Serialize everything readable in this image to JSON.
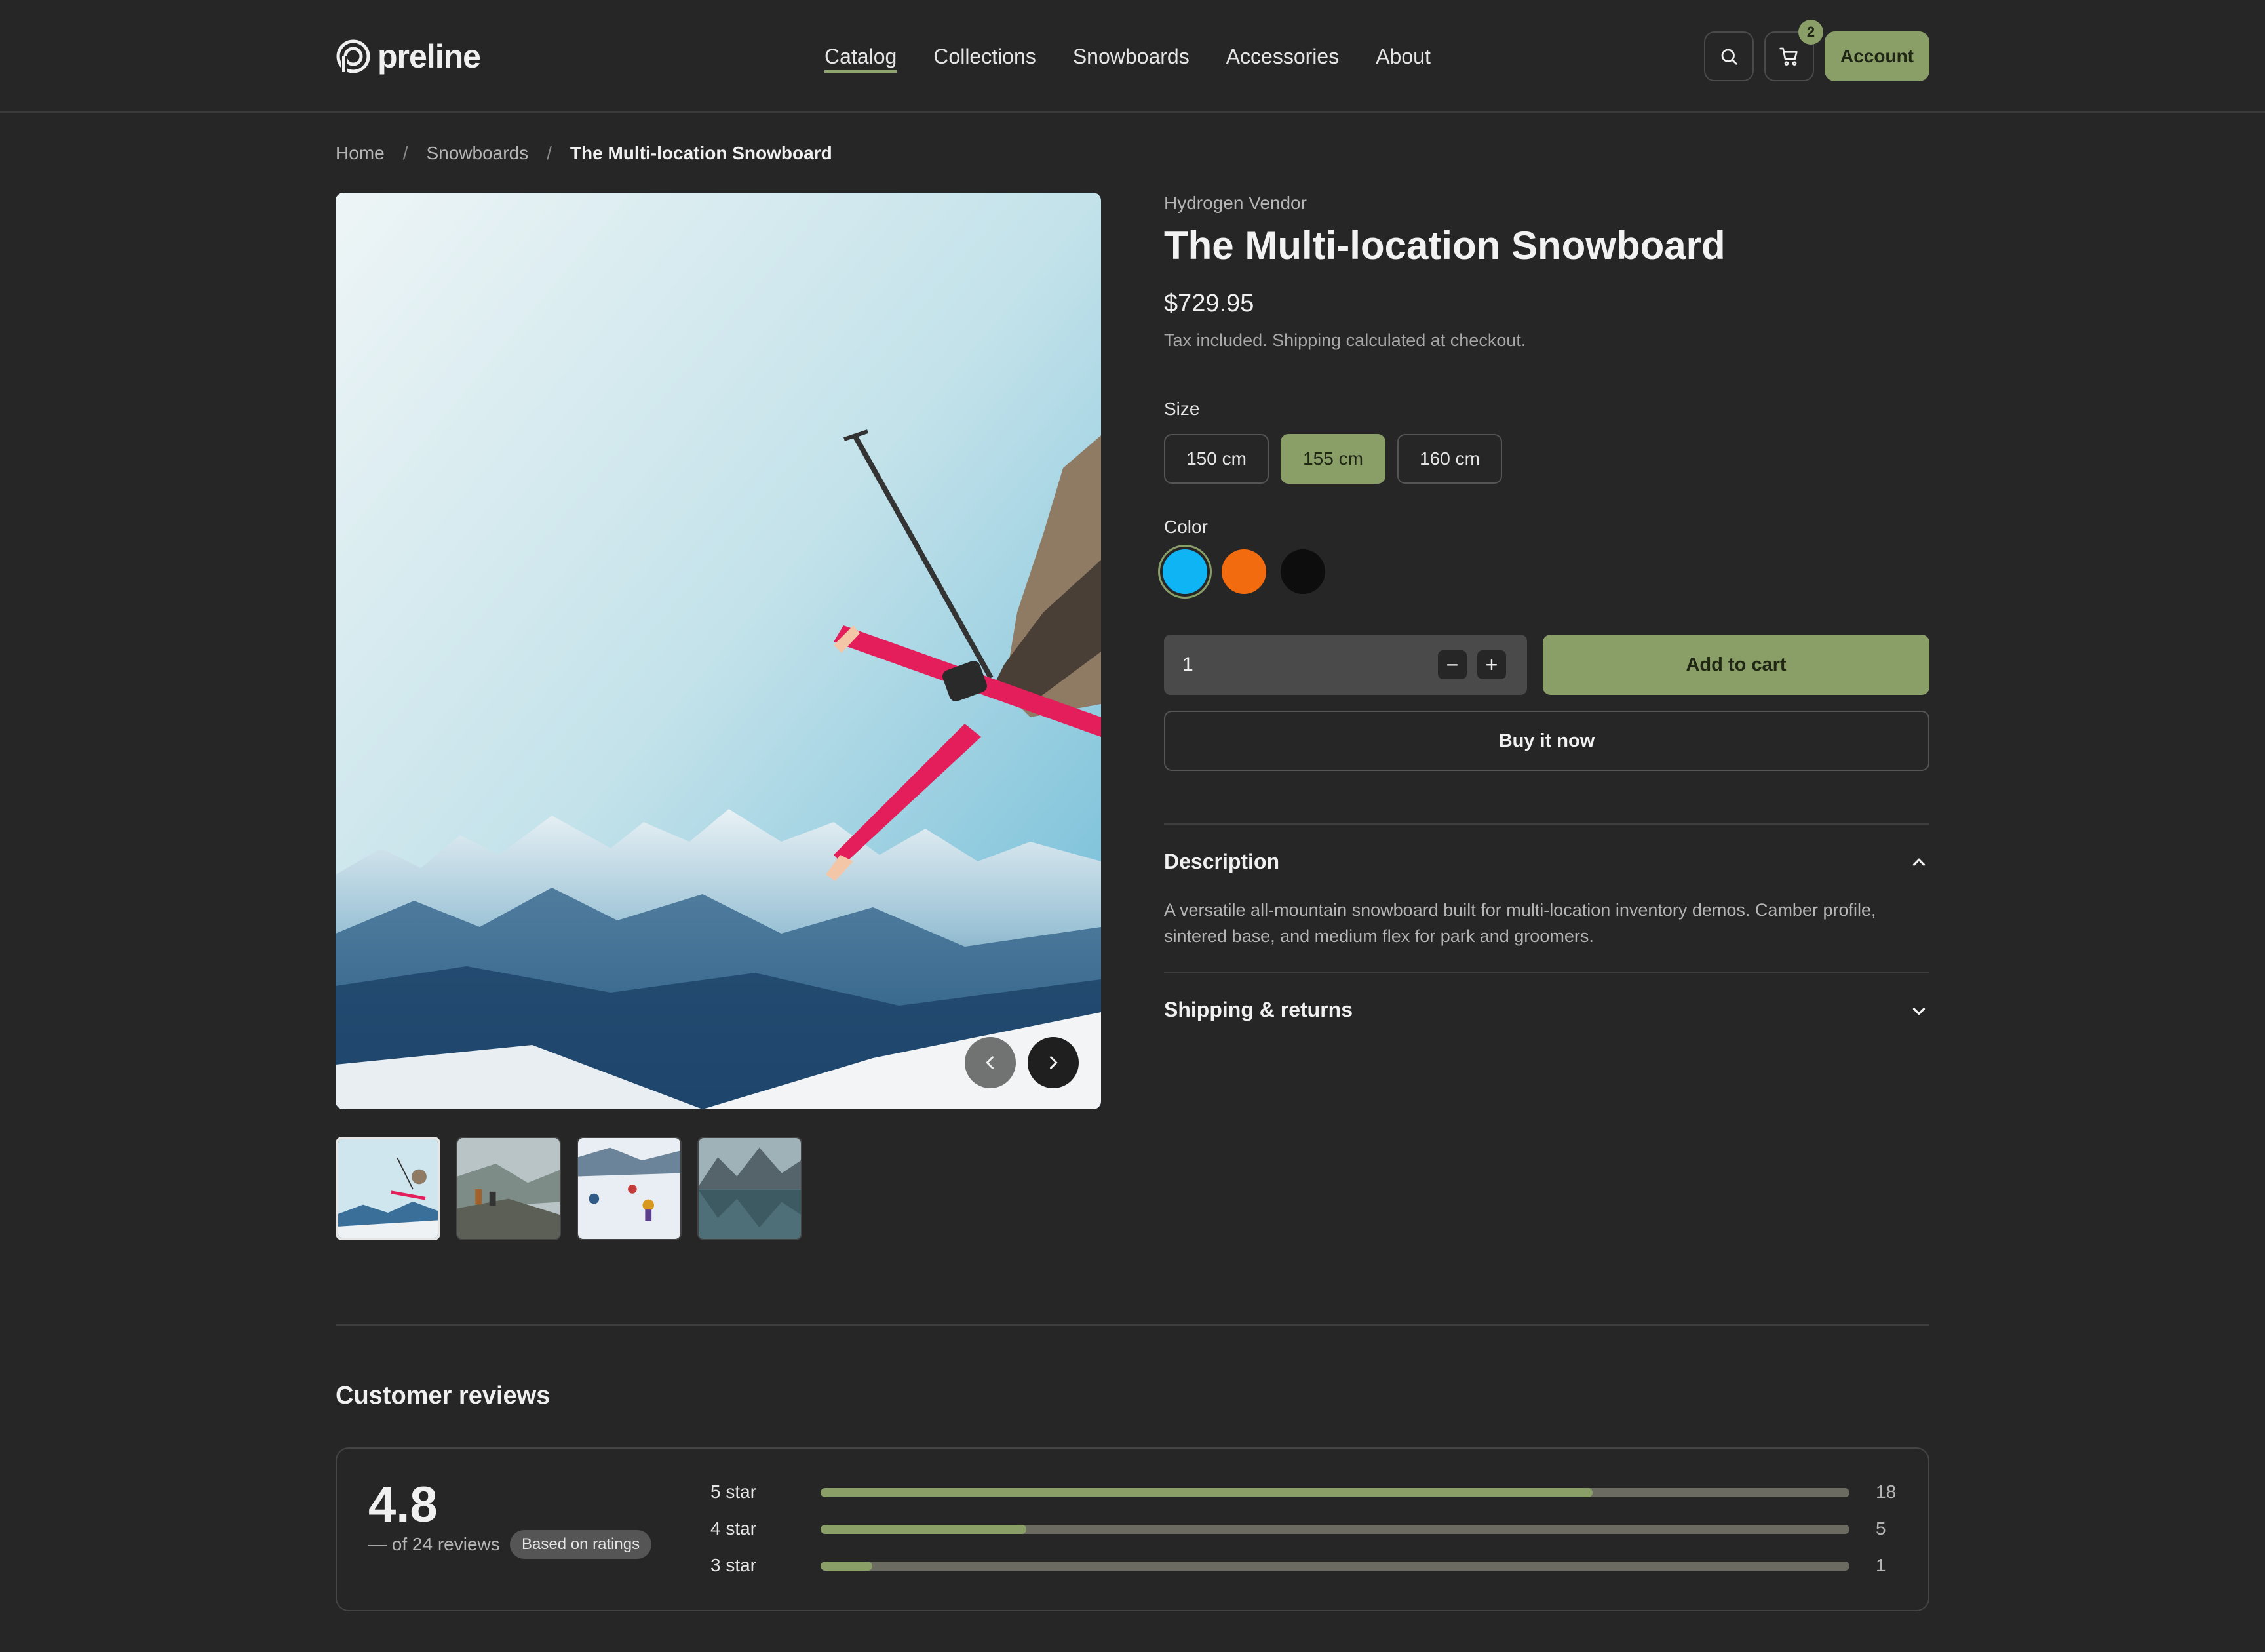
{
  "header": {
    "logo_text": "preline",
    "nav": [
      "Catalog",
      "Collections",
      "Snowboards",
      "Accessories",
      "About"
    ],
    "active_nav": "Catalog",
    "cart_count": "2",
    "account_label": "Account"
  },
  "breadcrumb": {
    "home": "Home",
    "category": "Snowboards",
    "current": "The Multi-location Snowboard"
  },
  "gallery": {
    "thumbnails": [
      "skier-jump",
      "hiker-cliff",
      "skiers-slope",
      "mountain-lake"
    ],
    "active_index": 0
  },
  "product": {
    "vendor": "Hydrogen Vendor",
    "title": "The Multi-location Snowboard",
    "price": "$729.95",
    "tax_note": "Tax included. Shipping calculated at checkout.",
    "size_label": "Size",
    "sizes": [
      "150 cm",
      "155 cm",
      "160 cm"
    ],
    "selected_size": "155 cm",
    "color_label": "Color",
    "colors": [
      "#0fb4f5",
      "#f26b0f",
      "#0d0d0d"
    ],
    "selected_color": "#0fb4f5",
    "quantity": "1",
    "minus": "−",
    "plus": "+",
    "add_to_cart": "Add to cart",
    "buy_now": "Buy it now"
  },
  "accordion": {
    "description_title": "Description",
    "description_text": "A versatile all-mountain snowboard built for multi-location inventory demos. Camber profile, sintered base, and medium flex for park and groomers.",
    "shipping_title": "Shipping & returns"
  },
  "reviews": {
    "title": "Customer reviews",
    "average": "4.8",
    "count_text": "— of 24 reviews",
    "badge": "Based on ratings",
    "rows": [
      {
        "label": "5 star",
        "count": "18",
        "fraction": 0.75
      },
      {
        "label": "4 star",
        "count": "5",
        "fraction": 0.2
      },
      {
        "label": "3 star",
        "count": "1",
        "fraction": 0.05
      }
    ]
  },
  "colors": {
    "background": "#262626",
    "accent": "#8a9e68"
  }
}
